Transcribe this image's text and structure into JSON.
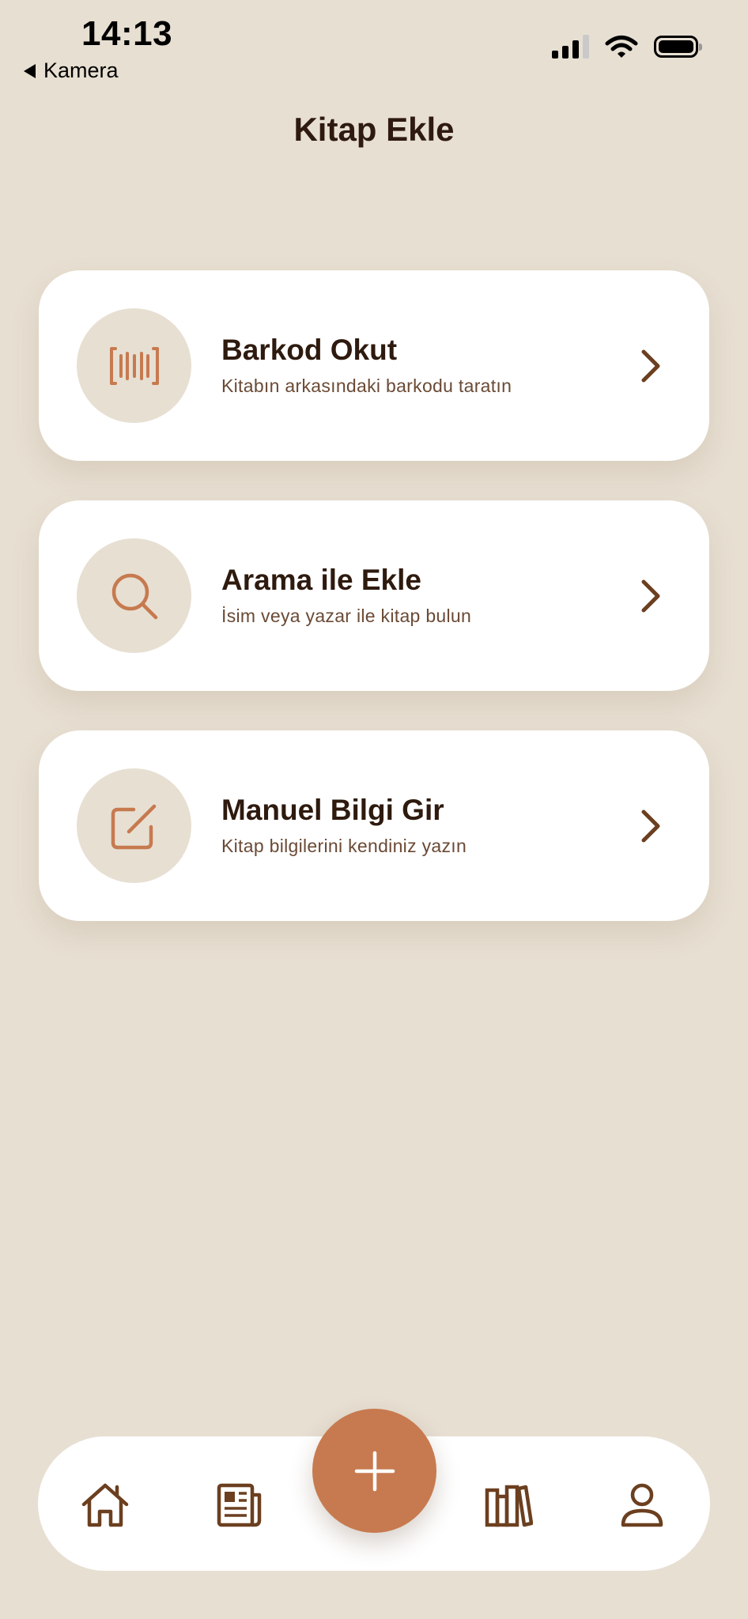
{
  "status_bar": {
    "time": "14:13",
    "back_app": "Kamera"
  },
  "header": {
    "title": "Kitap Ekle"
  },
  "options": [
    {
      "title": "Barkod Okut",
      "subtitle": "Kitabın arkasındaki barkodu taratın",
      "icon": "barcode-icon"
    },
    {
      "title": "Arama ile Ekle",
      "subtitle": "İsim veya yazar ile kitap bulun",
      "icon": "search-icon"
    },
    {
      "title": "Manuel Bilgi Gir",
      "subtitle": "Kitap bilgilerini kendiniz yazın",
      "icon": "edit-icon"
    }
  ],
  "tab_bar": {
    "items": [
      "home-icon",
      "newspaper-icon",
      "add-icon",
      "books-icon",
      "profile-icon"
    ]
  },
  "colors": {
    "background": "#E7DFD2",
    "accent": "#C77A4F",
    "text_dark": "#2E1A0E",
    "text_muted": "#6A4A35",
    "icon_brown": "#6B3F1F"
  }
}
